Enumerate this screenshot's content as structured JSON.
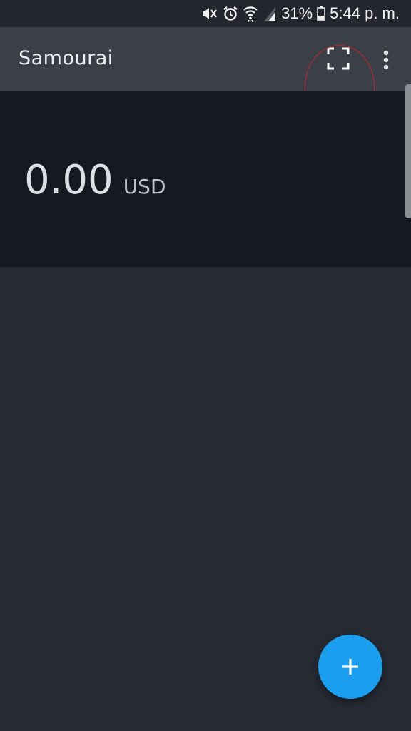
{
  "status_bar": {
    "icons": [
      "mute-vibrate-icon",
      "alarm-icon",
      "wifi-icon",
      "signal-icon",
      "battery-icon"
    ],
    "battery_percent": "31%",
    "time": "5:44 p. m."
  },
  "app_bar": {
    "title": "Samourai",
    "actions": [
      "scan-qr-icon",
      "more-vert-icon"
    ],
    "highlight_color": "#c0262a"
  },
  "balance": {
    "amount": "0.00",
    "currency": "USD"
  },
  "fab": {
    "icon": "plus-icon",
    "color": "#1a9ef0"
  },
  "colors": {
    "background": "#262a33",
    "app_bar": "#3a3f48",
    "balance_panel": "#161921"
  }
}
